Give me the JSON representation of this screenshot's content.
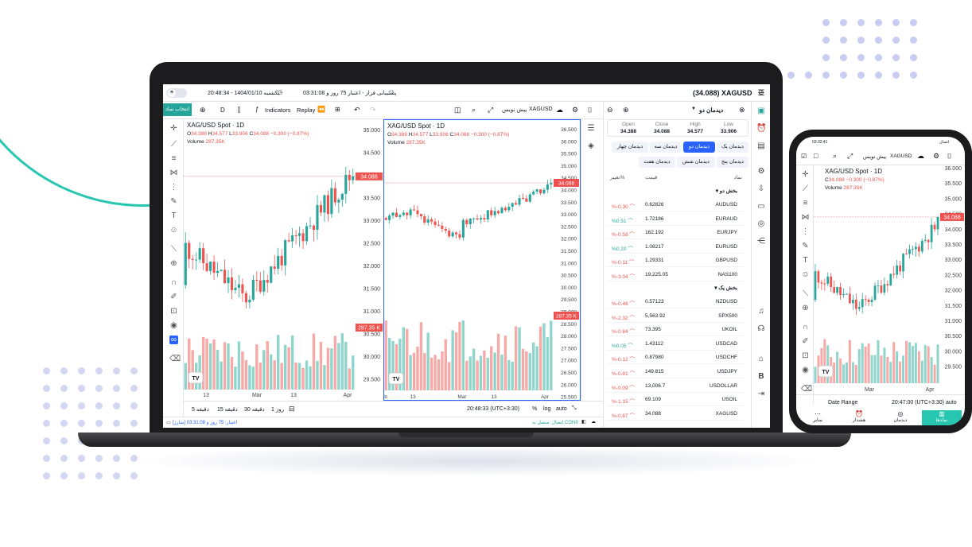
{
  "laptop": {
    "topbar": {
      "symbol_price": "(34.088) XAGUSD",
      "account": "پشتیبانی فراز - اعتبار 75 روز و 03:31:08",
      "datetime": "20:48:34 - 1404/01/10 یکشنبه"
    },
    "toolbar": {
      "select_symbol": "انتخاب نماد",
      "interval": "D",
      "indicators": "Indicators",
      "replay": "Replay",
      "symbol": "XAGUSD",
      "pre_write": "پیش نویس"
    },
    "left_chart": {
      "title": "XAG/USD Spot · 1D",
      "ohlc": {
        "o_label": "O",
        "o": "34.388",
        "h_label": "H",
        "h": "34.577",
        "l_label": "L",
        "l": "33.906",
        "c_label": "C",
        "c": "34.088",
        "chg": "−0.300 (−0.87%)"
      },
      "volume_label": "Volume",
      "volume_value": "287.35K",
      "y_ticks": [
        "35.000",
        "34.500",
        "34.000",
        "33.500",
        "33.000",
        "32.500",
        "32.000",
        "31.500",
        "31.000",
        "30.500",
        "30.000",
        "29.500"
      ],
      "x_ticks": [
        "13",
        "Mar",
        "13",
        "Apr"
      ],
      "price_tag": "34.088",
      "vol_tag": "287.35 K"
    },
    "right_chart": {
      "title": "XAG/USD Spot · 1D",
      "ohlc": {
        "o_label": "O",
        "o": "34.388",
        "h_label": "H",
        "h": "34.577",
        "l_label": "L",
        "l": "33.906",
        "c_label": "C",
        "c": "34.088",
        "chg": "−0.300 (−0.87%)"
      },
      "volume_label": "Volume",
      "volume_value": "287.35K",
      "y_ticks": [
        "36.500",
        "36.000",
        "35.500",
        "35.000",
        "34.500",
        "34.000",
        "33.500",
        "33.000",
        "32.500",
        "32.000",
        "31.500",
        "31.000",
        "30.500",
        "30.000",
        "29.500",
        "29.000",
        "28.500",
        "28.000",
        "27.500",
        "27.000",
        "26.500",
        "26.000",
        "25.500"
      ],
      "x_ticks": [
        "b",
        "13",
        "Mar",
        "13",
        "Apr"
      ],
      "price_tag": "34.088",
      "vol_tag": "287.35 K"
    },
    "bottombar": {
      "ranges": [
        "5 دقیقه",
        "15 دقیقه",
        "30 دقیقه",
        "1 روز"
      ],
      "time": "20:48:33 (UTC+3:30)",
      "pct": "%",
      "log": "log",
      "auto": "auto"
    },
    "status": {
      "left": "اعتبار: 75 روز و 03:31:08 [شارژ]",
      "right": "اتصال: متصل به CON9"
    },
    "watchlist": {
      "title": "دیدمان دو",
      "quote": {
        "open_label": "Open",
        "open": "34.388",
        "close_label": "Close",
        "close": "34.088",
        "high_label": "High",
        "high": "34.577",
        "low_label": "Low",
        "low": "33.906"
      },
      "tabs": [
        "دیدمان یک",
        "دیدمان دو",
        "دیدمان سه",
        "دیدمان چهار",
        "دیدمان پنج",
        "دیدمان شش",
        "دیدمان هفت"
      ],
      "headers": {
        "symbol": "نماد",
        "price": "قیمت",
        "change": "تغییر%"
      },
      "section1": "بخش دو",
      "rows1": [
        {
          "symbol": "AUDUSD",
          "price": "0.62826",
          "change": "%-0.30"
        },
        {
          "symbol": "EURAUD",
          "price": "1.72186",
          "change": "%0.51"
        },
        {
          "symbol": "EURJPY",
          "price": "162.192",
          "change": "%-0.58"
        },
        {
          "symbol": "EURUSD",
          "price": "1.08217",
          "change": "%0.20"
        },
        {
          "symbol": "GBPUSD",
          "price": "1.29331",
          "change": "%-0.11"
        },
        {
          "symbol": "NAS100",
          "price": "19,225.05",
          "change": "%-3.04"
        }
      ],
      "section2": "بخش یک",
      "rows2": [
        {
          "symbol": "NZDUSD",
          "price": "0.57123",
          "change": "%-0.46"
        },
        {
          "symbol": "SPX500",
          "price": "5,563.92",
          "change": "%-2.32"
        },
        {
          "symbol": "UKOIL",
          "price": "73.395",
          "change": "%-0.84"
        },
        {
          "symbol": "USDCAD",
          "price": "1.43112",
          "change": "%0.05"
        },
        {
          "symbol": "USDCHF",
          "price": "0.87980",
          "change": "%-0.12"
        },
        {
          "symbol": "USDJPY",
          "price": "149.815",
          "change": "%-0.81"
        },
        {
          "symbol": "USDOLLAR",
          "price": "13,006.7",
          "change": "%-0.09"
        },
        {
          "symbol": "USOIL",
          "price": "69.109",
          "change": "%-1.15"
        },
        {
          "symbol": "XAGUSD",
          "price": "34.088",
          "change": "%-0.87"
        }
      ]
    }
  },
  "phone": {
    "status_left": "03:32:41",
    "status_right": "اتصال",
    "symbol": "XAGUSD",
    "pre_write": "پیش نویس",
    "chart_title": "XAG/USD Spot · 1D",
    "ohlc": {
      "c_label": "C",
      "c": "34.088",
      "chg": "−0.300 (−0.87%)"
    },
    "volume_label": "Volume",
    "volume_value": "287.35K",
    "y_ticks": [
      "36.000",
      "35.500",
      "35.000",
      "34.500",
      "34.000",
      "33.500",
      "33.000",
      "32.500",
      "32.000",
      "31.500",
      "31.000",
      "30.500",
      "30.000",
      "29.500"
    ],
    "x_ticks": [
      "Mar",
      "Apr"
    ],
    "price_tag": "34.088",
    "date_range": "Date Range",
    "time": "20:47:00 (UTC+3:30)",
    "auto": "auto",
    "tabs": [
      "نمادها",
      "دیدمان",
      "هشدار",
      "سایر"
    ]
  },
  "colors": {
    "up": "#26a69a",
    "down": "#ef5350",
    "accent": "#2962ff",
    "brand": "#26c6b0"
  }
}
